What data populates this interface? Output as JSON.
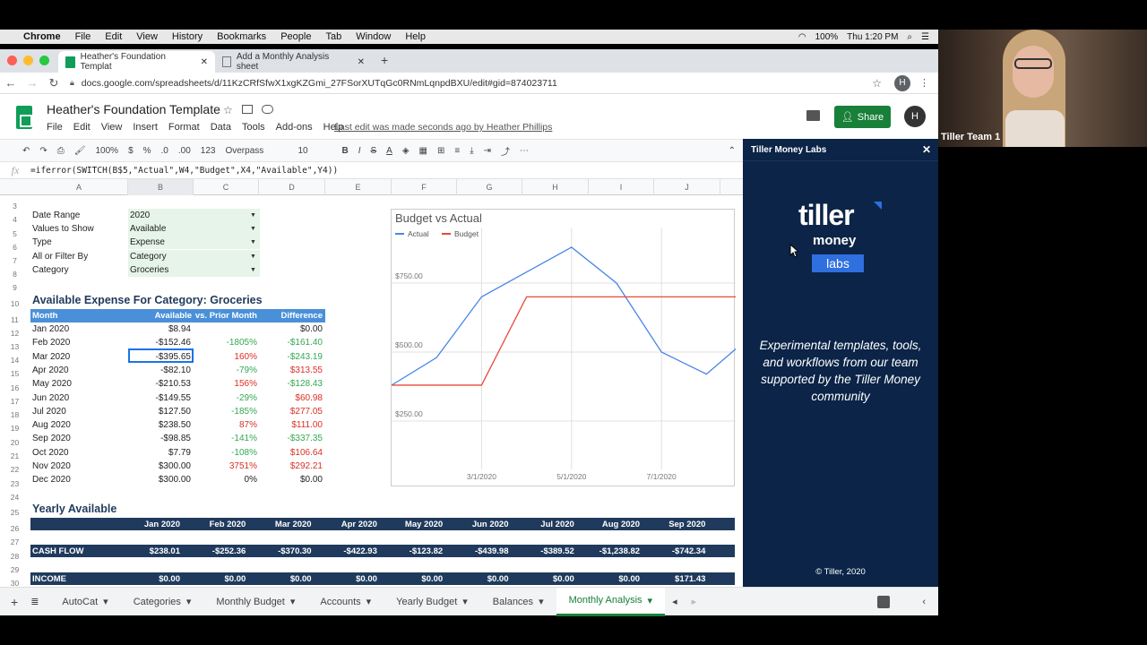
{
  "mac": {
    "menus": [
      "Chrome",
      "File",
      "Edit",
      "View",
      "History",
      "Bookmarks",
      "People",
      "Tab",
      "Window",
      "Help"
    ],
    "battery": "100%",
    "clock": "Thu 1:20 PM"
  },
  "tabs": [
    {
      "title": "Heather's Foundation Templat"
    },
    {
      "title": "Add a Monthly Analysis sheet"
    }
  ],
  "url": "docs.google.com/spreadsheets/d/11KzCRfSfwX1xgKZGmi_27FSorXUTqGc0RNmLqnpdBXU/edit#gid=874023711",
  "browser_avatar": "H",
  "doc": {
    "title": "Heather's Foundation Template",
    "menus": [
      "File",
      "Edit",
      "View",
      "Insert",
      "Format",
      "Data",
      "Tools",
      "Add-ons",
      "Help"
    ],
    "last_edit": "Last edit was made seconds ago by Heather Phillips",
    "share": "Share",
    "user": "H"
  },
  "toolbar": {
    "zoom": "100%",
    "currency": "$",
    "percent": "%",
    "dec_dec": ".0",
    "dec_inc": ".00",
    "format": "123",
    "font": "Overpass",
    "size": "10"
  },
  "formula": "=iferror(SWITCH(B$5,\"Actual\",W4,\"Budget\",X4,\"Available\",Y4))",
  "formula_fx": "fx",
  "columns": [
    "A",
    "B",
    "C",
    "D",
    "E",
    "F",
    "G",
    "H",
    "I",
    "J"
  ],
  "rownums": [
    "3",
    "4",
    "5",
    "6",
    "7",
    "8",
    "9",
    "10",
    "11",
    "12",
    "13",
    "14",
    "15",
    "16",
    "17",
    "18",
    "19",
    "20",
    "21",
    "22",
    "23",
    "24",
    "25",
    "26",
    "27",
    "28",
    "29",
    "30"
  ],
  "params": [
    {
      "label": "Date Range",
      "value": "2020"
    },
    {
      "label": "Values to Show",
      "value": "Available"
    },
    {
      "label": "Type",
      "value": "Expense"
    },
    {
      "label": "All or Filter By",
      "value": "Category"
    },
    {
      "label": "Category",
      "value": "Groceries"
    }
  ],
  "section1": "Available Expense For Category: Groceries",
  "table_headers": [
    "Month",
    "Available",
    "vs. Prior Month",
    "Difference"
  ],
  "table_rows": [
    [
      "Jan 2020",
      "$8.94",
      "",
      "$0.00"
    ],
    [
      "Feb 2020",
      "-$152.46",
      "-1805%",
      "-$161.40"
    ],
    [
      "Mar 2020",
      "-$395.65",
      "160%",
      "-$243.19"
    ],
    [
      "Apr 2020",
      "-$82.10",
      "-79%",
      "$313.55"
    ],
    [
      "May 2020",
      "-$210.53",
      "156%",
      "-$128.43"
    ],
    [
      "Jun 2020",
      "-$149.55",
      "-29%",
      "$60.98"
    ],
    [
      "Jul 2020",
      "$127.50",
      "-185%",
      "$277.05"
    ],
    [
      "Aug 2020",
      "$238.50",
      "87%",
      "$111.00"
    ],
    [
      "Sep 2020",
      "-$98.85",
      "-141%",
      "-$337.35"
    ],
    [
      "Oct 2020",
      "$7.79",
      "-108%",
      "$106.64"
    ],
    [
      "Nov 2020",
      "$300.00",
      "3751%",
      "$292.21"
    ],
    [
      "Dec 2020",
      "$300.00",
      "0%",
      "$0.00"
    ]
  ],
  "section2": "Yearly Available",
  "yearly_months": [
    "Jan 2020",
    "Feb 2020",
    "Mar 2020",
    "Apr 2020",
    "May 2020",
    "Jun 2020",
    "Jul 2020",
    "Aug 2020",
    "Sep 2020"
  ],
  "cashflow": {
    "label": "CASH FLOW",
    "values": [
      "$238.01",
      "-$252.36",
      "-$370.30",
      "-$422.93",
      "-$123.82",
      "-$439.98",
      "-$389.52",
      "-$1,238.82",
      "-$742.34"
    ]
  },
  "income": {
    "label": "INCOME",
    "values": [
      "$0.00",
      "$0.00",
      "$0.00",
      "$0.00",
      "$0.00",
      "$0.00",
      "$0.00",
      "$0.00",
      "$171.43"
    ]
  },
  "chart_data": {
    "type": "line",
    "title": "Budget vs Actual",
    "xlabel": "",
    "ylabel": "",
    "ylim": [
      0,
      1000
    ],
    "x_ticks": [
      "3/1/2020",
      "5/1/2020",
      "7/1/2020"
    ],
    "y_ticks": [
      "$250.00",
      "$500.00",
      "$750.00"
    ],
    "x": [
      "1/1/2020",
      "2/1/2020",
      "3/1/2020",
      "4/1/2020",
      "5/1/2020",
      "6/1/2020",
      "7/1/2020",
      "8/1/2020",
      "9/1/2020"
    ],
    "series": [
      {
        "name": "Actual",
        "color": "#4a86e8",
        "values": [
          380,
          480,
          700,
          790,
          880,
          750,
          500,
          420,
          560
        ]
      },
      {
        "name": "Budget",
        "color": "#e84a3b",
        "values": [
          380,
          380,
          380,
          700,
          700,
          700,
          700,
          700,
          700
        ]
      }
    ],
    "legend": "top-left",
    "grid": true
  },
  "sheet_tabs": [
    "AutoCat",
    "Categories",
    "Monthly Budget",
    "Accounts",
    "Yearly Budget",
    "Balances",
    "Monthly Analysis"
  ],
  "side": {
    "header": "Tiller Money Labs",
    "logo_word1": "tiller",
    "logo_word2": "money",
    "logo_word3": "labs",
    "text": "Experimental templates, tools, and workflows from our team supported by the Tiller Money community",
    "footer": "© Tiller, 2020"
  },
  "video": {
    "name": "Tiller Team 1"
  }
}
